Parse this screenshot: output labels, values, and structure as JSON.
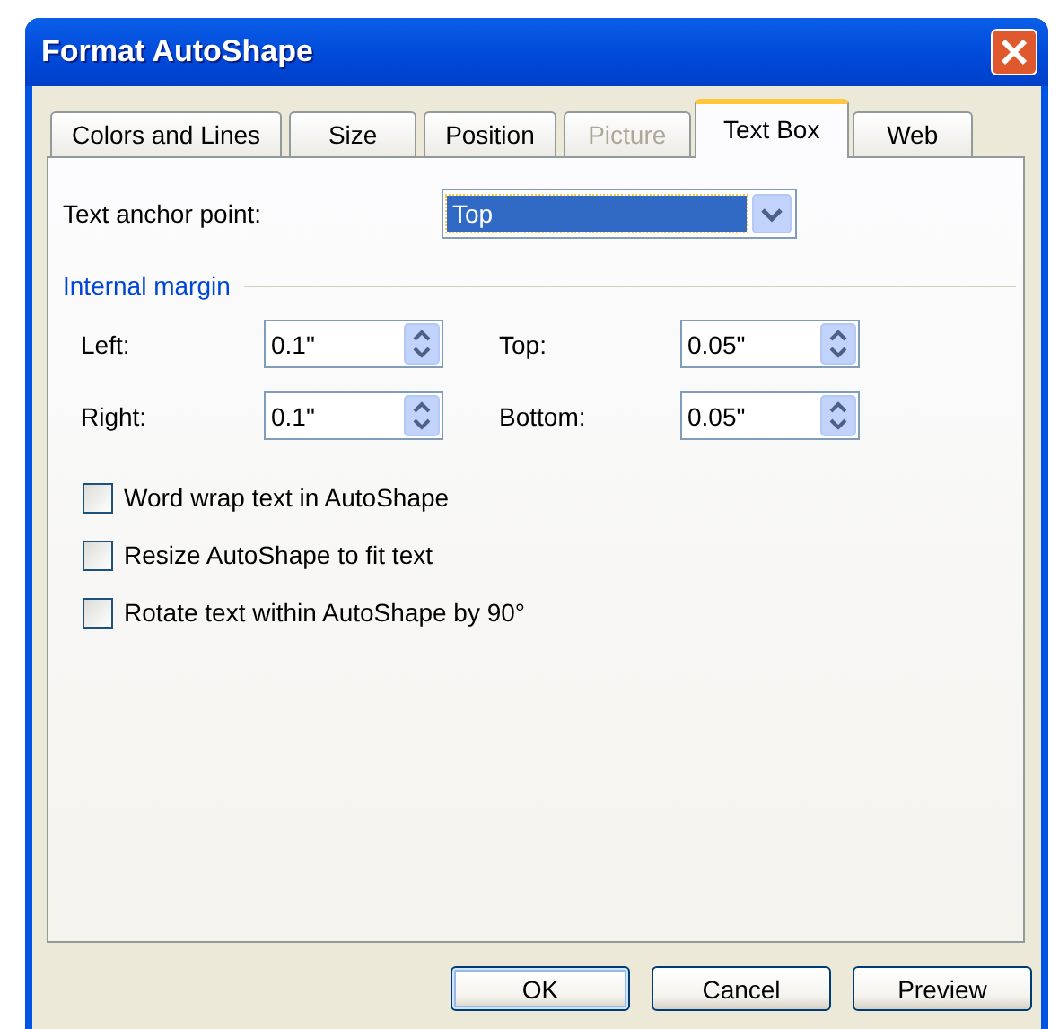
{
  "window": {
    "title": "Format AutoShape"
  },
  "tabs": [
    {
      "label": "Colors and Lines",
      "selected": false,
      "disabled": false
    },
    {
      "label": "Size",
      "selected": false,
      "disabled": false
    },
    {
      "label": "Position",
      "selected": false,
      "disabled": false
    },
    {
      "label": "Picture",
      "selected": false,
      "disabled": true
    },
    {
      "label": "Text Box",
      "selected": true,
      "disabled": false
    },
    {
      "label": "Web",
      "selected": false,
      "disabled": false
    }
  ],
  "anchor": {
    "label": "Text anchor point:",
    "value": "Top",
    "focused": true
  },
  "internal_margin": {
    "heading": "Internal margin",
    "fields": [
      {
        "label": "Left:",
        "value": "0.1\""
      },
      {
        "label": "Top:",
        "value": "0.05\""
      },
      {
        "label": "Right:",
        "value": "0.1\""
      },
      {
        "label": "Bottom:",
        "value": "0.05\""
      }
    ]
  },
  "options": [
    {
      "label": "Word wrap text in AutoShape",
      "checked": false
    },
    {
      "label": "Resize AutoShape to fit text",
      "checked": false
    },
    {
      "label": "Rotate text within AutoShape by 90°",
      "checked": false
    }
  ],
  "buttons": [
    {
      "label": "OK",
      "default": true
    },
    {
      "label": "Cancel",
      "default": false
    },
    {
      "label": "Preview",
      "default": false
    }
  ]
}
